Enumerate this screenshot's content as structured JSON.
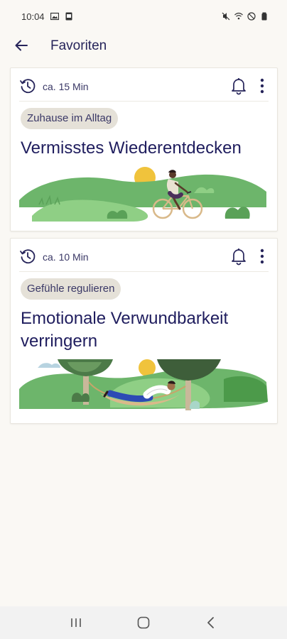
{
  "status_bar": {
    "time": "10:04",
    "icons": [
      "gallery-icon",
      "screenshot-icon",
      "mute-icon",
      "wifi-icon",
      "dnd-icon",
      "battery-icon"
    ]
  },
  "app_bar": {
    "title": "Favoriten",
    "back_icon": "arrow-left-icon"
  },
  "cards": [
    {
      "duration": "ca. 15 Min",
      "category": "Zuhause im Alltag",
      "title": "Vermisstes Wiederentdecken",
      "illustration": "cyclist-in-hills"
    },
    {
      "duration": "ca. 10 Min",
      "category": "Gefühle regulieren",
      "title": "Emotionale Verwundbarkeit verringern",
      "illustration": "person-in-hammock"
    }
  ],
  "colors": {
    "background": "#faf8f4",
    "primary_text": "#26245a",
    "chip_bg": "#e5e1d8",
    "green": "#6db56b",
    "dark_green": "#4c7a48"
  },
  "nav_bar": {
    "icons": [
      "recents-icon",
      "home-icon",
      "back-icon"
    ]
  }
}
